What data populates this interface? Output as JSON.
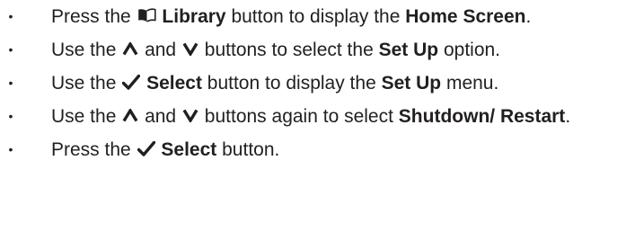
{
  "bullet_glyph": "•",
  "instructions": [
    {
      "parts": {
        "t1": "Press the",
        "b1": "Library",
        "t2": "button to display the",
        "b2": "Home Screen",
        "t3": "."
      },
      "icons": [
        "library-book-icon"
      ]
    },
    {
      "parts": {
        "t1": "Use the",
        "t2": "and",
        "t3": "buttons to select the",
        "b1": "Set Up",
        "t4": "option."
      },
      "icons": [
        "up-arrow-icon",
        "down-arrow-icon"
      ]
    },
    {
      "parts": {
        "t1": "Use the",
        "b1": "Select",
        "t2": "button to display the",
        "b2": "Set Up",
        "t3": "menu."
      },
      "icons": [
        "checkmark-icon"
      ]
    },
    {
      "parts": {
        "t1": "Use the",
        "t2": "and",
        "t3": "buttons again to select",
        "b1": "Shutdown/ Restart",
        "t4": "."
      },
      "icons": [
        "up-arrow-icon",
        "down-arrow-icon"
      ]
    },
    {
      "parts": {
        "t1": "Press the",
        "b1": "Select",
        "t2": "button."
      },
      "icons": [
        "checkmark-icon"
      ]
    }
  ],
  "colors": {
    "text": "#231f20",
    "background": "#ffffff"
  }
}
